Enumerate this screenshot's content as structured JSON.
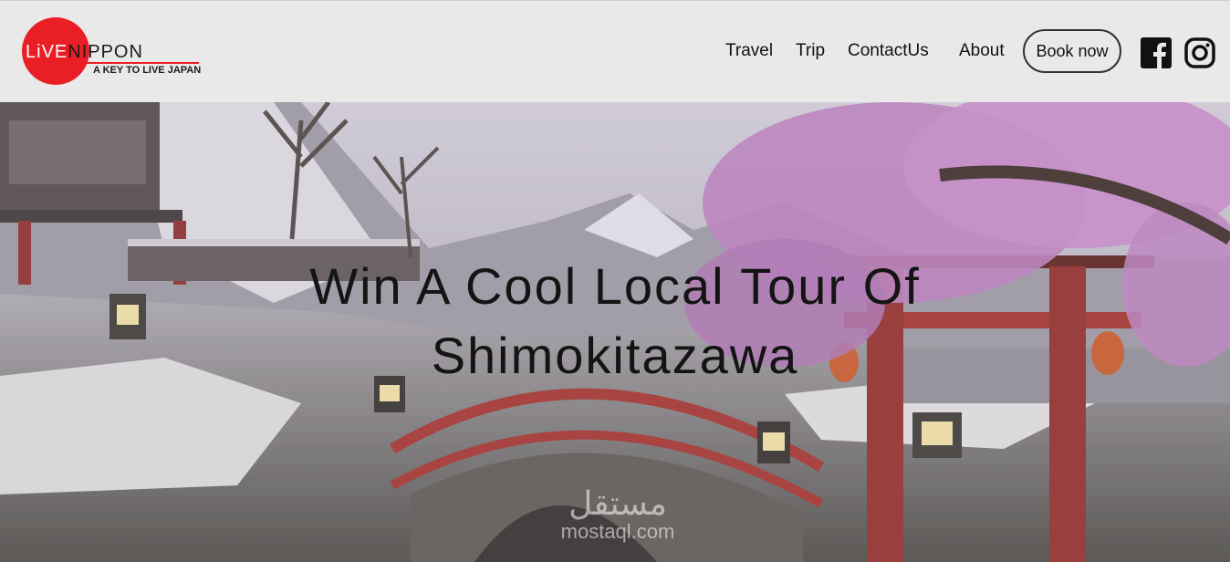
{
  "header": {
    "logo": {
      "word_live": "LiVE",
      "word_nippon": "NIPPON",
      "tagline": "A KEY TO LIVE JAPAN"
    },
    "nav": [
      {
        "label": "Travel"
      },
      {
        "label": "Trip"
      },
      {
        "label": "ContactUs"
      },
      {
        "label": "About"
      }
    ],
    "book_label": "Book now",
    "social": [
      {
        "icon": "facebook-icon"
      },
      {
        "icon": "instagram-icon"
      }
    ]
  },
  "hero": {
    "headline_line1": "Win A Cool Local Tour Of",
    "headline_line2": "Shimokitazawa",
    "watermark_ar": "مستقل",
    "watermark_en": "mostaql.com"
  },
  "colors": {
    "brand_red": "#ea1f26",
    "header_bg": "#e9e9ea",
    "text": "#141414"
  }
}
